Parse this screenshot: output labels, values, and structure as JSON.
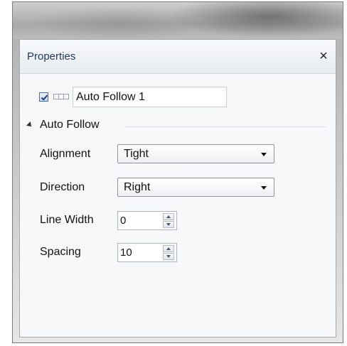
{
  "panel": {
    "title": "Properties",
    "close_glyph": "×"
  },
  "element": {
    "enabled": true,
    "icon": "layout-icon",
    "name": "Auto Follow 1"
  },
  "section": {
    "title": "Auto Follow",
    "expanded": true
  },
  "properties": {
    "alignment": {
      "label": "Alignment",
      "value": "Tight"
    },
    "direction": {
      "label": "Direction",
      "value": "Right"
    },
    "line_width": {
      "label": "Line Width",
      "value": "0"
    },
    "spacing": {
      "label": "Spacing",
      "value": "10"
    }
  },
  "colors": {
    "title_text": "#1e395b",
    "checkbox_check": "#1f3f7a"
  }
}
